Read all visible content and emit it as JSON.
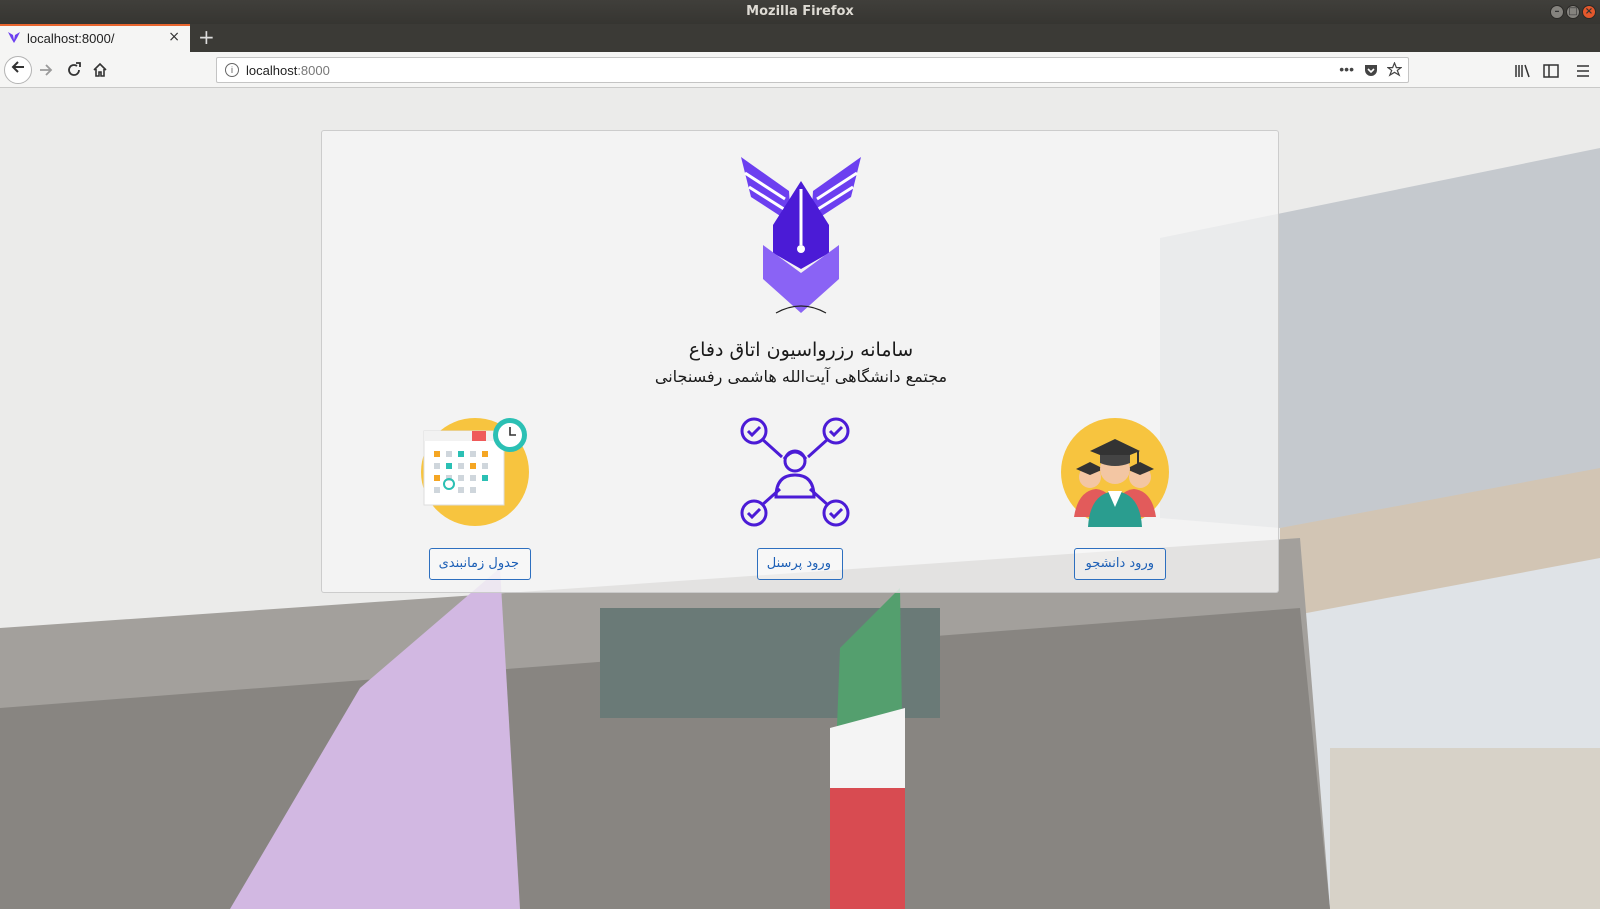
{
  "window": {
    "title": "Mozilla Firefox"
  },
  "tab": {
    "title": "localhost:8000/",
    "close": "×"
  },
  "newtab": "+",
  "url": {
    "host": "localhost",
    "port": ":8000"
  },
  "page": {
    "title": "سامانه رزرواسیون اتاق دفاع",
    "subtitle": "مجتمع دانشگاهی آیت‌الله هاشمی رفسنجانی",
    "options": [
      {
        "label": "جدول زمانبندی",
        "icon": "calendar-clock-icon"
      },
      {
        "label": "ورود پرسنل",
        "icon": "personnel-network-icon"
      },
      {
        "label": "ورود دانشجو",
        "icon": "graduates-icon"
      }
    ]
  },
  "colors": {
    "accent": "#1c5fb6",
    "logo": "#6c3ff0",
    "firefox_tab": "#e8652e"
  }
}
